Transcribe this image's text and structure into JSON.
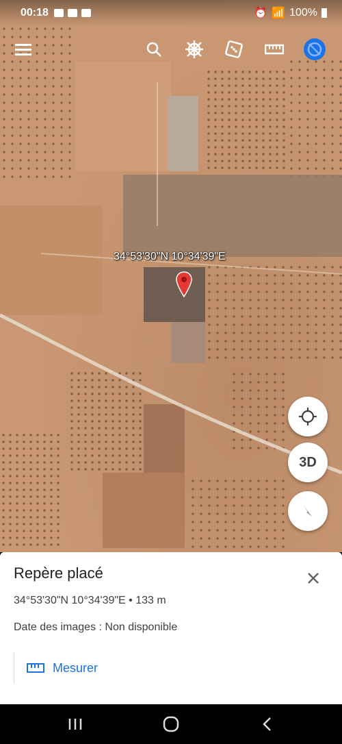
{
  "status_bar": {
    "time": "00:18",
    "battery": "100%"
  },
  "toolbar": {
    "icons": [
      "menu-icon",
      "search-icon",
      "voyager-icon",
      "feeling-lucky-icon",
      "ruler-icon",
      "account-icon"
    ]
  },
  "map": {
    "marker_label": "34°53'30\"N 10°34'39\"E",
    "pin_color": "#e53935",
    "fab_3d_label": "3D"
  },
  "sheet": {
    "title": "Repère placé",
    "coords": "34°53'30\"N 10°34'39\"E • 133 m",
    "date": "Date des images : Non disponible",
    "measure_label": "Mesurer",
    "accent_color": "#1a73e8"
  }
}
